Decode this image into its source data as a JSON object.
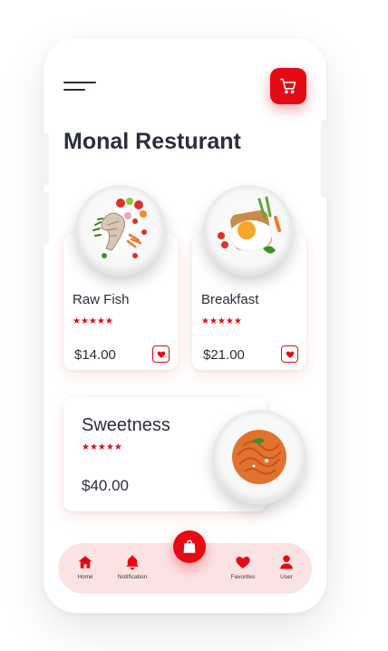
{
  "restaurant": {
    "title": "Monal Resturant"
  },
  "colors": {
    "accent": "#e50a14",
    "nav_bg": "#fbe3e4",
    "text": "#2b2f3a"
  },
  "dishes": [
    {
      "name": "Raw Fish",
      "rating": "★★★★★",
      "price": "$14.00",
      "image": "fish-plate"
    },
    {
      "name": "Breakfast",
      "rating": "★★★★★",
      "price": "$21.00",
      "image": "egg-toast-plate"
    }
  ],
  "featured": {
    "name": "Sweetness",
    "rating": "★★★★★",
    "price": "$40.00",
    "image": "spaghetti-plate"
  },
  "bottom_nav": {
    "items": [
      {
        "label": "Home",
        "icon": "home-icon"
      },
      {
        "label": "Notification",
        "icon": "bell-icon"
      },
      {
        "label": "Favorites",
        "icon": "heart-icon"
      },
      {
        "label": "User",
        "icon": "user-icon"
      }
    ],
    "center_icon": "shopping-bag-icon"
  },
  "header": {
    "menu_icon": "hamburger-menu-icon",
    "cart_icon": "cart-icon"
  }
}
